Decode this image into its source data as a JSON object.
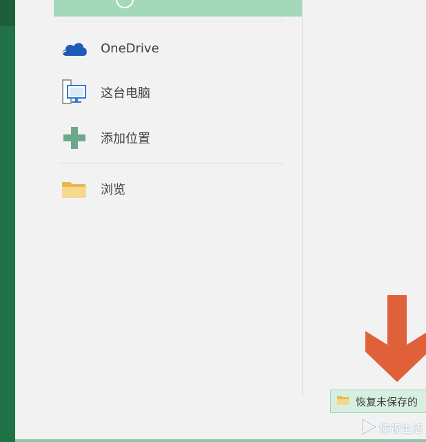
{
  "places": [
    {
      "id": "onedrive",
      "label": "OneDrive",
      "icon": "onedrive-cloud-icon"
    },
    {
      "id": "this-pc",
      "label": "这台电脑",
      "icon": "computer-icon"
    },
    {
      "id": "add-place",
      "label": "添加位置",
      "icon": "plus-icon"
    },
    {
      "id": "browse",
      "label": "浏览",
      "icon": "folder-icon"
    }
  ],
  "recover_button": {
    "label": "恢复未保存的",
    "icon": "folder-icon"
  },
  "annotation": {
    "icon": "down-arrow-icon",
    "color": "#e0603a"
  },
  "watermark": {
    "text": "懂视生活",
    "icon": "play-logo-icon"
  },
  "colors": {
    "accent_green": "#217346",
    "selected_bg": "#a3d9b8",
    "recover_bg": "#d7efe0",
    "onedrive_blue": "#1e5bb8",
    "plus_green": "#6aaa8a",
    "folder_yellow": "#f0c76a"
  }
}
